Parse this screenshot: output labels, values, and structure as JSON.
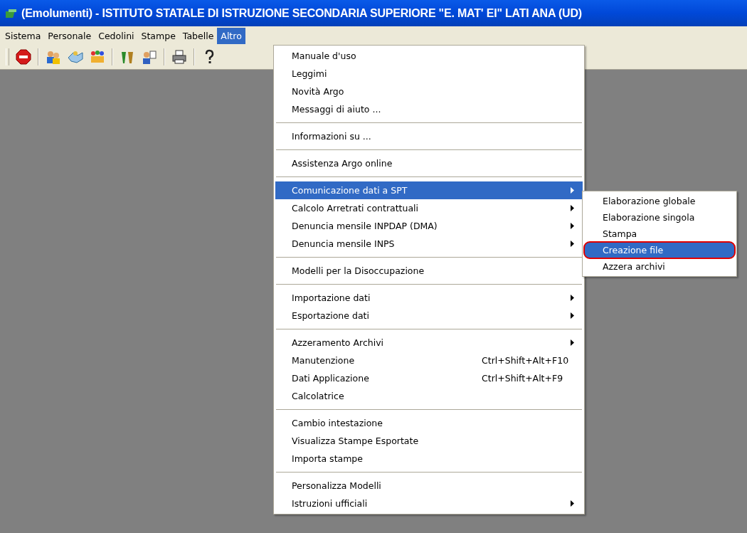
{
  "window": {
    "title": "(Emolumenti) - ISTITUTO STATALE DI ISTRUZIONE SECONDARIA SUPERIORE \"E. MAT' EI\" LATI ANA (UD)"
  },
  "menu_bar": [
    {
      "label": "Sistema",
      "selected": false
    },
    {
      "label": "Personale",
      "selected": false
    },
    {
      "label": "Cedolini",
      "selected": false
    },
    {
      "label": "Stampe",
      "selected": false
    },
    {
      "label": "Tabelle",
      "selected": false
    },
    {
      "label": "Altro",
      "selected": true
    }
  ],
  "toolbar": [
    {
      "kind": "stop"
    },
    {
      "kind": "sep"
    },
    {
      "kind": "people"
    },
    {
      "kind": "hands"
    },
    {
      "kind": "group"
    },
    {
      "kind": "sep"
    },
    {
      "kind": "figures"
    },
    {
      "kind": "person-doc"
    },
    {
      "kind": "sep"
    },
    {
      "kind": "printer"
    },
    {
      "kind": "sep"
    },
    {
      "kind": "help"
    }
  ],
  "menu": {
    "groups": [
      [
        {
          "label": "Manuale d'uso",
          "selected": false,
          "submenu": false
        },
        {
          "label": "Leggimi",
          "selected": false,
          "submenu": false
        },
        {
          "label": "Novità Argo",
          "selected": false,
          "submenu": false
        },
        {
          "label": "Messaggi di aiuto ...",
          "selected": false,
          "submenu": false
        }
      ],
      [
        {
          "label": "Informazioni su ...",
          "selected": false,
          "submenu": false
        }
      ],
      [
        {
          "label": "Assistenza Argo online",
          "selected": false,
          "submenu": false
        }
      ],
      [
        {
          "label": "Comunicazione dati a SPT",
          "selected": true,
          "submenu": true
        },
        {
          "label": "Calcolo Arretrati contrattuali",
          "selected": false,
          "submenu": true
        },
        {
          "label": "Denuncia mensile INPDAP (DMA)",
          "selected": false,
          "submenu": true
        },
        {
          "label": "Denuncia mensile INPS",
          "selected": false,
          "submenu": true
        }
      ],
      [
        {
          "label": "Modelli per la Disoccupazione",
          "selected": false,
          "submenu": false
        }
      ],
      [
        {
          "label": "Importazione dati",
          "selected": false,
          "submenu": true
        },
        {
          "label": "Esportazione dati",
          "selected": false,
          "submenu": true
        }
      ],
      [
        {
          "label": "Azzeramento Archivi",
          "selected": false,
          "submenu": true
        },
        {
          "label": "Manutenzione",
          "shortcut": "Ctrl+Shift+Alt+F10",
          "selected": false,
          "submenu": false
        },
        {
          "label": "Dati Applicazione",
          "shortcut": "Ctrl+Shift+Alt+F9",
          "selected": false,
          "submenu": false
        },
        {
          "label": "Calcolatrice",
          "selected": false,
          "submenu": false
        }
      ],
      [
        {
          "label": "Cambio intestazione",
          "selected": false,
          "submenu": false
        },
        {
          "label": "Visualizza Stampe Esportate",
          "selected": false,
          "submenu": false
        },
        {
          "label": "Importa stampe",
          "selected": false,
          "submenu": false
        }
      ],
      [
        {
          "label": "Personalizza Modelli",
          "selected": false,
          "submenu": false
        },
        {
          "label": "Istruzioni ufficiali",
          "selected": false,
          "submenu": true
        }
      ]
    ]
  },
  "submenu": [
    {
      "label": "Elaborazione globale",
      "selected": false,
      "circled": false
    },
    {
      "label": "Elaborazione singola",
      "selected": false,
      "circled": false
    },
    {
      "label": "Stampa",
      "selected": false,
      "circled": false
    },
    {
      "label": "Creazione file",
      "selected": true,
      "circled": true
    },
    {
      "label": "Azzera archivi",
      "selected": false,
      "circled": false
    }
  ]
}
